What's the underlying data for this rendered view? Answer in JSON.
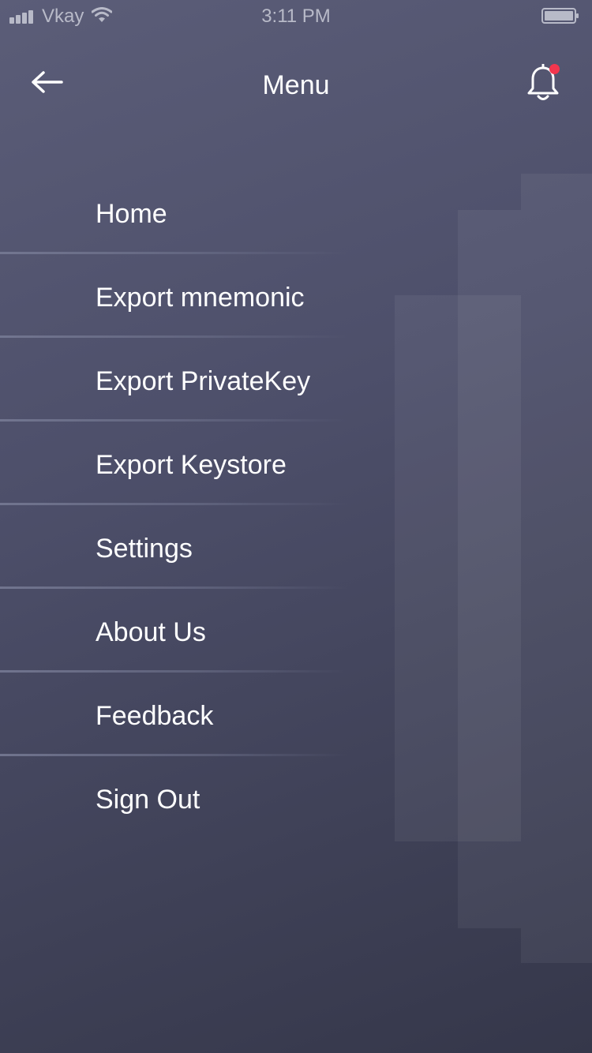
{
  "status_bar": {
    "carrier": "Vkay",
    "time": "3:11 PM",
    "icons": [
      "signal-icon",
      "wifi-icon",
      "battery-icon"
    ]
  },
  "header": {
    "title": "Menu",
    "back_icon": "arrow-left-icon",
    "notification_icon": "bell-icon",
    "notification_badge_color": "#f2364e"
  },
  "menu": {
    "items": [
      {
        "label": "Home"
      },
      {
        "label": "Export mnemonic"
      },
      {
        "label": "Export PrivateKey"
      },
      {
        "label": "Export Keystore"
      },
      {
        "label": "Settings"
      },
      {
        "label": "About Us"
      },
      {
        "label": "Feedback"
      },
      {
        "label": "Sign Out"
      }
    ]
  },
  "colors": {
    "background_top": "#5b5d78",
    "background_bottom": "#35374a",
    "text": "#ffffff",
    "status_text": "#b8bac8"
  }
}
